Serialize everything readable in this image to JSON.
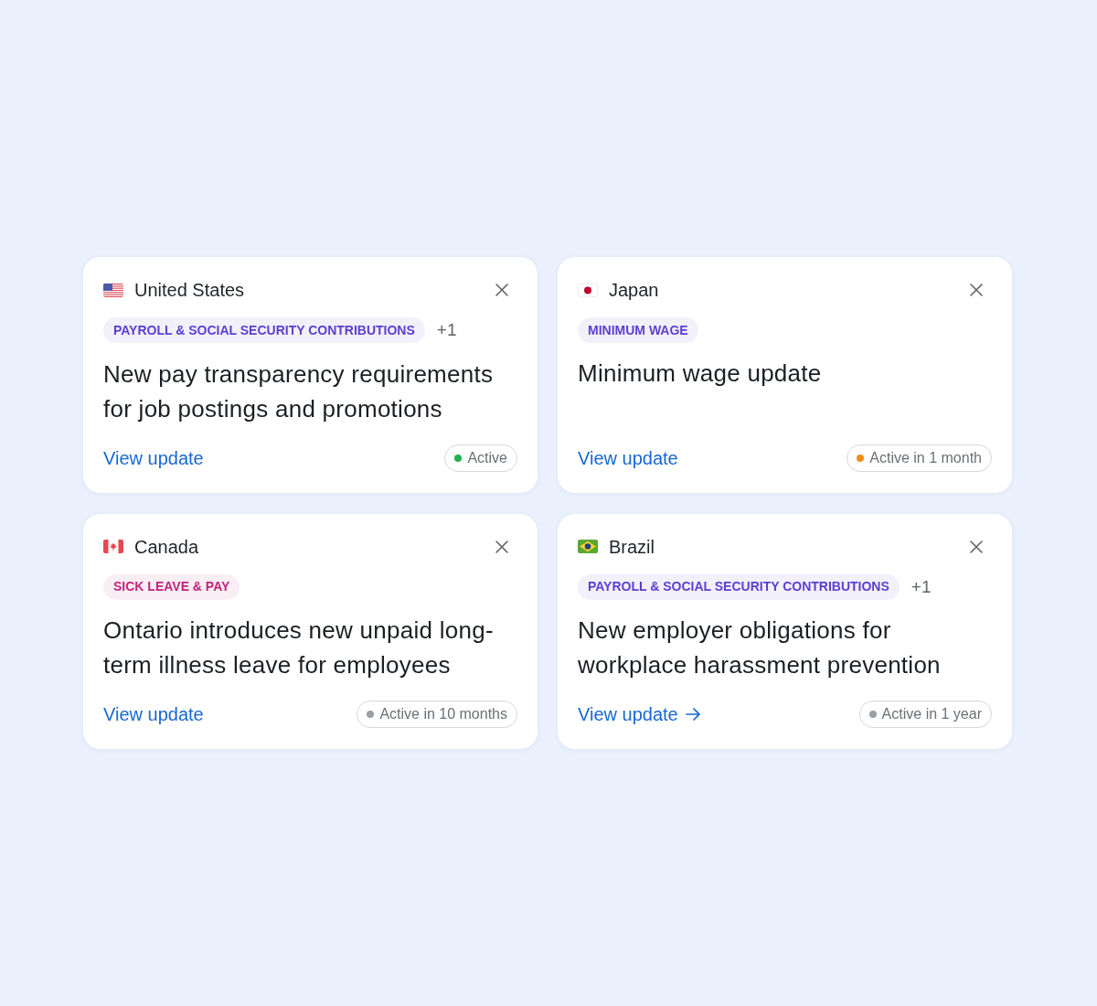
{
  "cards": [
    {
      "country": "United States",
      "flag": {
        "kind": "us"
      },
      "tag": {
        "label": "PAYROLL & SOCIAL SECURITY CONTRIBUTIONS",
        "color": "#5b3fd0"
      },
      "more": "+1",
      "title": "New pay transparency requirements for job postings and promotions",
      "link": {
        "label": "View update",
        "arrow": false
      },
      "status": {
        "label": "Active",
        "color": "#22b14c"
      }
    },
    {
      "country": "Japan",
      "flag": {
        "kind": "jp"
      },
      "tag": {
        "label": "MINIMUM WAGE",
        "color": "#5b3fd0"
      },
      "title": "Minimum wage update",
      "link": {
        "label": "View update",
        "arrow": false
      },
      "status": {
        "label": "Active in 1 month",
        "color": "#f08c1a"
      }
    },
    {
      "country": "Canada",
      "flag": {
        "kind": "ca"
      },
      "tag": {
        "label": "SICK LEAVE & PAY",
        "color": "#c0267a"
      },
      "title": "Ontario introduces new unpaid long-term illness leave for employees",
      "link": {
        "label": "View update",
        "arrow": false
      },
      "status": {
        "label": "Active in 10 months",
        "color": "#9a9ea5"
      }
    },
    {
      "country": "Brazil",
      "flag": {
        "kind": "br"
      },
      "tag": {
        "label": "PAYROLL & SOCIAL SECURITY CONTRIBUTIONS",
        "color": "#5b3fd0"
      },
      "more": "+1",
      "title": "New employer obligations for workplace harassment prevention",
      "link": {
        "label": "View update",
        "arrow": true
      },
      "status": {
        "label": "Active in 1 year",
        "color": "#9a9ea5"
      }
    }
  ]
}
